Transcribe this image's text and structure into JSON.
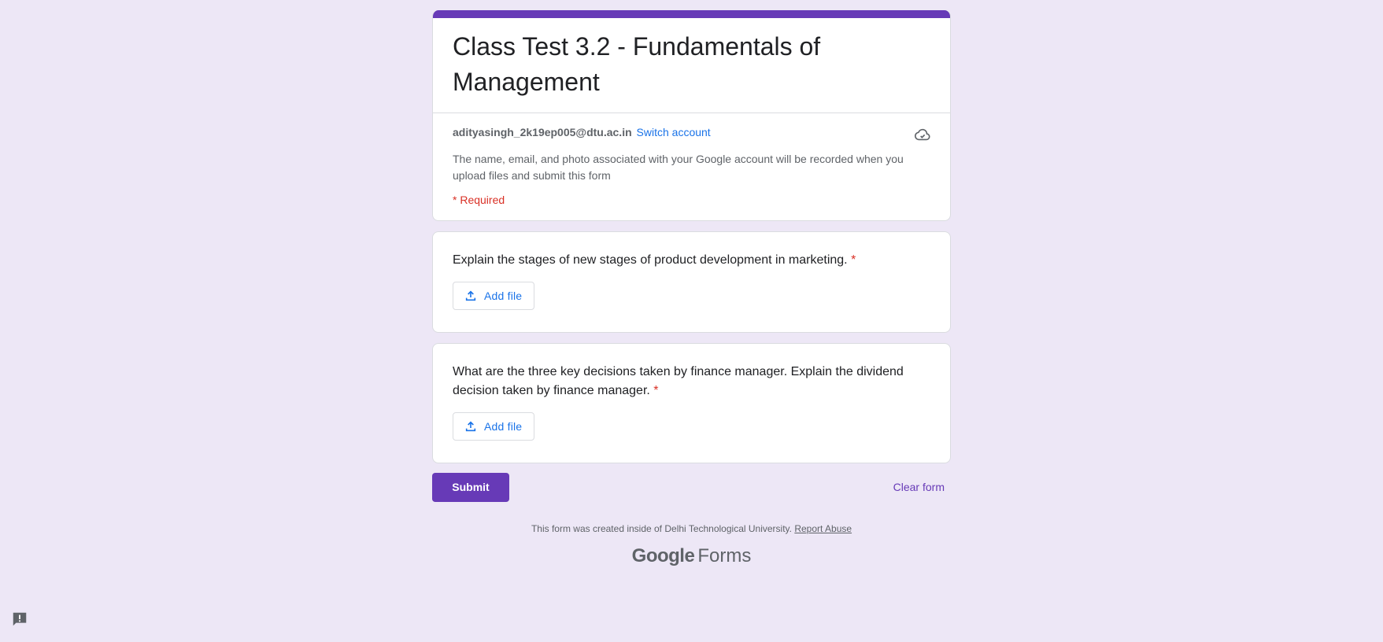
{
  "form": {
    "title": "Class Test 3.2 - Fundamentals of Management",
    "account_email": "adityasingh_2k19ep005@dtu.ac.in",
    "switch_account": "Switch account",
    "notice": "The name, email, and photo associated with your Google account will be recorded when you upload files and submit this form",
    "required_note": "* Required"
  },
  "questions": [
    {
      "text": "Explain the stages of new stages of product development in marketing.",
      "required_mark": "*",
      "button_label": "Add file"
    },
    {
      "text": "What are the three key decisions taken by finance manager. Explain the dividend decision taken by finance manager.",
      "required_mark": "*",
      "button_label": "Add file"
    }
  ],
  "actions": {
    "submit_label": "Submit",
    "clear_label": "Clear form"
  },
  "footer": {
    "created_text": "This form was created inside of Delhi Technological University.",
    "report_abuse": "Report Abuse",
    "brand_google": "Google",
    "brand_forms": "Forms"
  },
  "icons": {
    "cloud": "cloud-sync-icon",
    "upload": "upload-icon",
    "feedback": "feedback-icon"
  },
  "colors": {
    "accent": "#673ab7",
    "background": "#ede7f6",
    "link": "#1a73e8",
    "required": "#d93025"
  }
}
